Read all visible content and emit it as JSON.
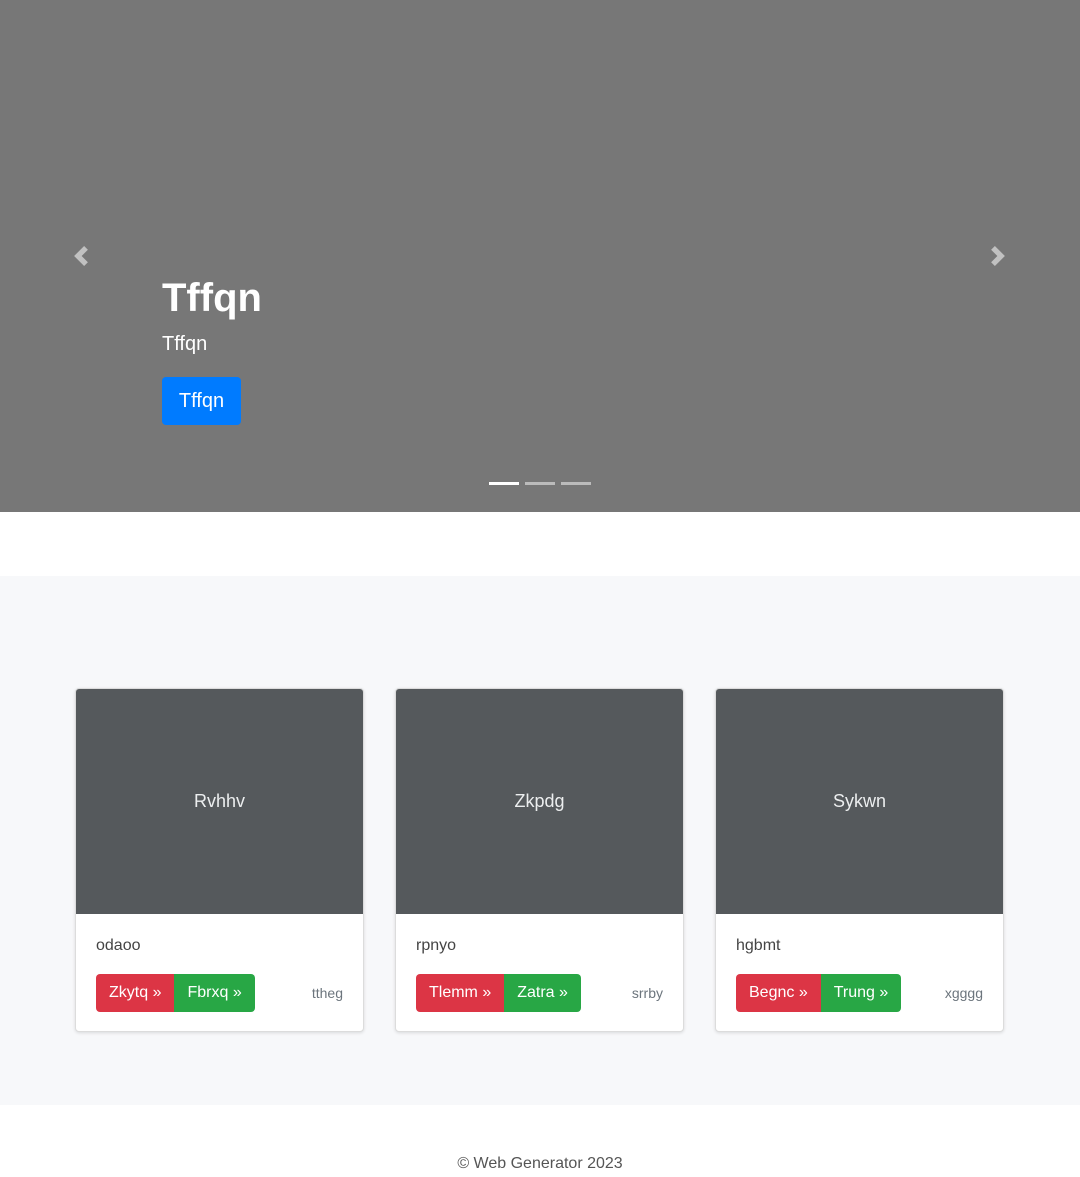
{
  "carousel": {
    "title": "Tffqn",
    "subtitle": "Tffqn",
    "button_label": "Tffqn",
    "prev_icon": "chevron-left-icon",
    "next_icon": "chevron-right-icon",
    "indicator_count": 3,
    "active_indicator": 0
  },
  "cards": [
    {
      "image_label": "Rvhhv",
      "text": "odaoo",
      "btn_red": "Zkytq »",
      "btn_green": "Fbrxq »",
      "muted": "ttheg"
    },
    {
      "image_label": "Zkpdg",
      "text": "rpnyo",
      "btn_red": "Tlemm »",
      "btn_green": "Zatra »",
      "muted": "srrby"
    },
    {
      "image_label": "Sykwn",
      "text": "hgbmt",
      "btn_red": "Begnc »",
      "btn_green": "Trung »",
      "muted": "xgggg"
    }
  ],
  "footer": {
    "text": "© Web Generator 2023"
  },
  "colors": {
    "carousel_bg": "#777777",
    "primary": "#007bff",
    "danger": "#dc3545",
    "success": "#28a745",
    "card_image_bg": "#55595c"
  }
}
